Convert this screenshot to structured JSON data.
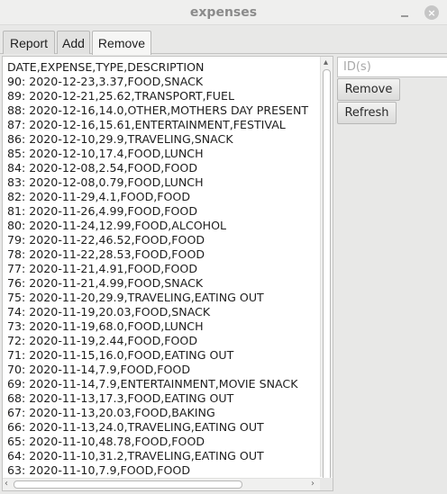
{
  "window": {
    "title": "expenses"
  },
  "tabs": [
    {
      "label": "Report"
    },
    {
      "label": "Add"
    },
    {
      "label": "Remove"
    }
  ],
  "records": {
    "header": "DATE,EXPENSE,TYPE,DESCRIPTION",
    "lines": [
      "90: 2020-12-23,3.37,FOOD,SNACK",
      "89: 2020-12-21,25.62,TRANSPORT,FUEL",
      "88: 2020-12-16,14.0,OTHER,MOTHERS DAY PRESENT",
      "87: 2020-12-16,15.61,ENTERTAINMENT,FESTIVAL",
      "86: 2020-12-10,29.9,TRAVELING,SNACK",
      "85: 2020-12-10,17.4,FOOD,LUNCH",
      "84: 2020-12-08,2.54,FOOD,FOOD",
      "83: 2020-12-08,0.79,FOOD,LUNCH",
      "82: 2020-11-29,4.1,FOOD,FOOD",
      "81: 2020-11-26,4.99,FOOD,FOOD",
      "80: 2020-11-24,12.99,FOOD,ALCOHOL",
      "79: 2020-11-22,46.52,FOOD,FOOD",
      "78: 2020-11-22,28.53,FOOD,FOOD",
      "77: 2020-11-21,4.91,FOOD,FOOD",
      "76: 2020-11-21,4.99,FOOD,SNACK",
      "75: 2020-11-20,29.9,TRAVELING,EATING OUT",
      "74: 2020-11-19,20.03,FOOD,SNACK",
      "73: 2020-11-19,68.0,FOOD,LUNCH",
      "72: 2020-11-19,2.44,FOOD,FOOD",
      "71: 2020-11-15,16.0,FOOD,EATING OUT",
      "70: 2020-11-14,7.9,FOOD,FOOD",
      "69: 2020-11-14,7.9,ENTERTAINMENT,MOVIE SNACK",
      "68: 2020-11-13,17.3,FOOD,EATING OUT",
      "67: 2020-11-13,20.03,FOOD,BAKING",
      "66: 2020-11-13,24.0,TRAVELING,EATING OUT",
      "65: 2020-11-10,48.78,FOOD,FOOD",
      "64: 2020-11-10,31.2,TRAVELING,EATING OUT",
      "63: 2020-11-10,7.9,FOOD,FOOD"
    ]
  },
  "remove_panel": {
    "id_placeholder": "ID(s)",
    "remove_label": "Remove",
    "refresh_label": "Refresh"
  },
  "icons": {
    "close": "×",
    "scroll_up": "▴",
    "scroll_left": "‹",
    "scroll_right": "›"
  }
}
